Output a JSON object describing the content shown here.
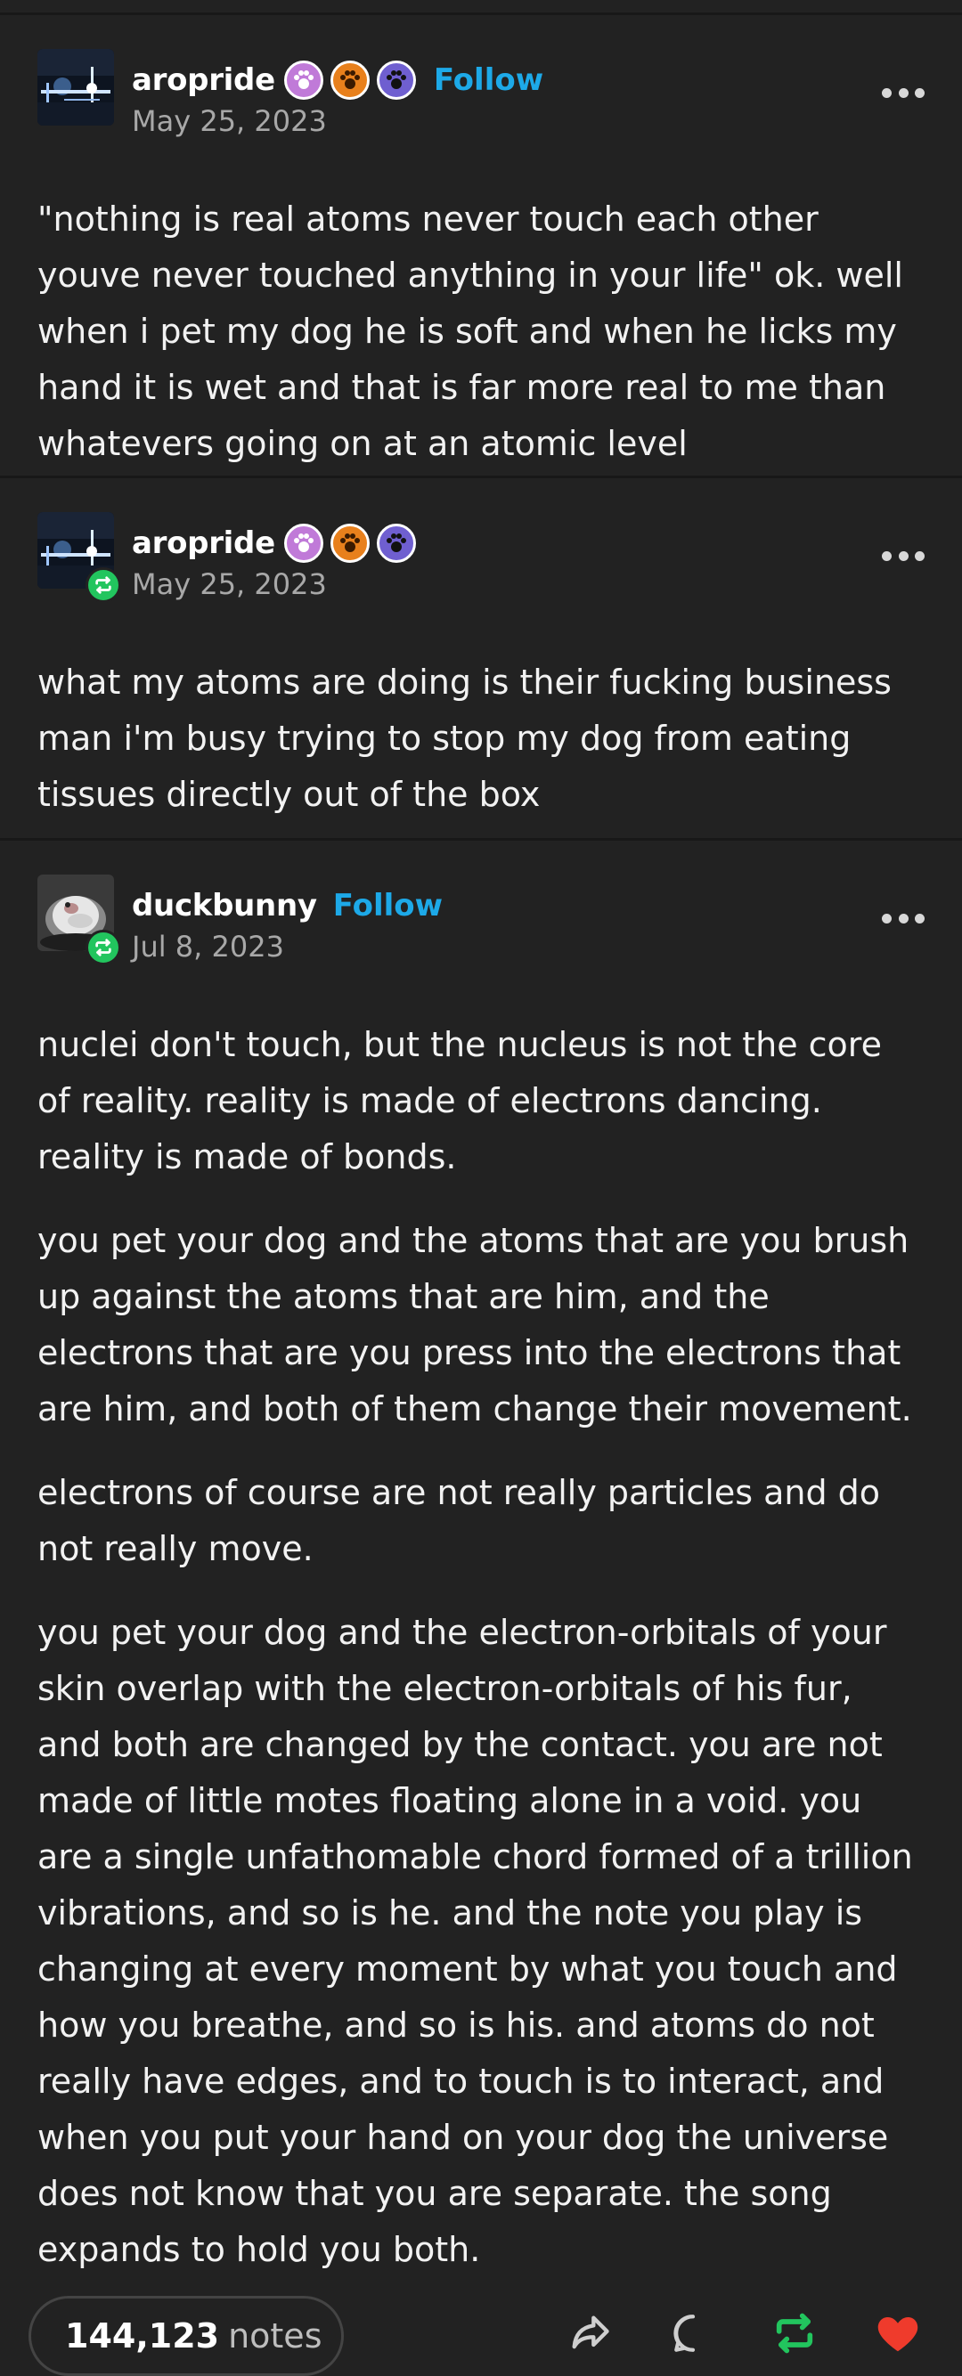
{
  "colors": {
    "background": "#222222",
    "follow": "#1da9e8",
    "reblog": "#22c55e",
    "like": "#ef3b2c",
    "text": "#f2f2f2",
    "muted": "#a8a8a8"
  },
  "posts": [
    {
      "username": "aropride",
      "date": "May 25, 2023",
      "follow_label": "Follow",
      "badges": [
        "paw-badge-icon",
        "paw-badge-icon",
        "paw-badge-icon"
      ],
      "paragraphs": [
        "\"nothing is real atoms never touch each other youve never touched anything in your life\" ok. well when i pet my dog he is soft and when he licks my hand it is wet and that is far more real to me than whatevers going on at an atomic level"
      ]
    },
    {
      "username": "aropride",
      "date": "May 25, 2023",
      "badges": [
        "paw-badge-icon",
        "paw-badge-icon",
        "paw-badge-icon"
      ],
      "paragraphs": [
        "what my atoms are doing is their fucking business man i'm busy trying to stop my dog from eating tissues directly out of the box"
      ]
    },
    {
      "username": "duckbunny",
      "date": "Jul 8, 2023",
      "follow_label": "Follow",
      "paragraphs": [
        "nuclei don't touch, but the nucleus is not the core of reality. reality is made of electrons dancing. reality is made of bonds.",
        "you pet your dog and the atoms that are you brush up against the atoms that are him, and the electrons that are you press into the electrons that are him, and both of them change their movement.",
        "electrons of course are not really particles and do not really move.",
        "you pet your dog and the electron-orbitals of your skin overlap with the electron-orbitals of his fur, and both are changed by the contact. you are not made of little motes floating alone in a void. you are a single unfathomable chord formed of a trillion vibrations, and so is he. and the note you play is changing at every moment by what you touch and how you breathe, and so is his. and atoms do not really have edges, and to touch is to interact, and when you put your hand on your dog the universe does not know that you are separate. the song expands to hold you both."
      ]
    }
  ],
  "footer": {
    "notes_count": "144,123",
    "notes_label": "notes",
    "actions": [
      "share-icon",
      "reply-icon",
      "reblog-icon",
      "like-icon"
    ]
  }
}
